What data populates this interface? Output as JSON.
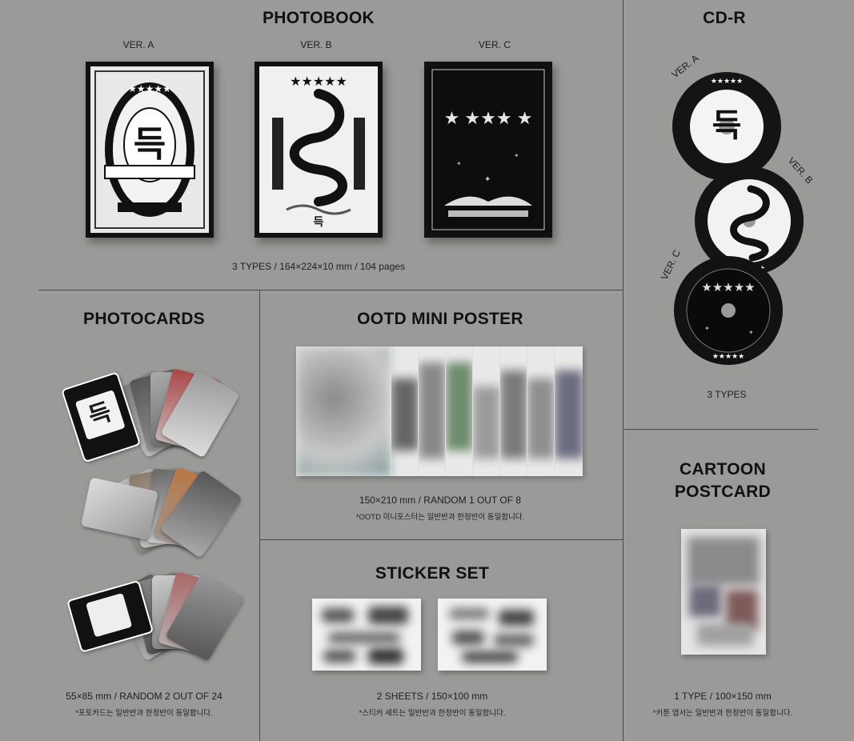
{
  "photobook": {
    "title": "PHOTOBOOK",
    "versions": [
      "VER. A",
      "VER. B",
      "VER. C"
    ],
    "spec": "3 TYPES / 164×224×10 mm / 104 pages"
  },
  "cdr": {
    "title": "CD-R",
    "versions": [
      "VER. A",
      "VER. B",
      "VER. C"
    ],
    "spec": "3 TYPES"
  },
  "photocards": {
    "title": "PHOTOCARDS",
    "spec": "55×85 mm / RANDOM 2 OUT OF 24",
    "note": "*포토카드는 일반반과 한정반이 동일합니다."
  },
  "poster": {
    "title": "OOTD MINI POSTER",
    "spec": "150×210 mm / RANDOM 1 OUT OF 8",
    "note": "*OOTD 미니포스터는 일반반과 한정반이 동일합니다."
  },
  "sticker": {
    "title": "STICKER SET",
    "spec": "2 SHEETS / 150×100 mm",
    "note": "*스티커 세트는 일반반과 한정반이 동일합니다."
  },
  "postcard": {
    "title_line1": "CARTOON",
    "title_line2": "POSTCARD",
    "spec": "1 TYPE / 100×150 mm",
    "note": "*카툰 엽서는 일반반과 한정반이 동일합니다."
  },
  "colors": {
    "background": "#9a9a98",
    "divider": "#4a4a4a",
    "text": "#111111"
  }
}
